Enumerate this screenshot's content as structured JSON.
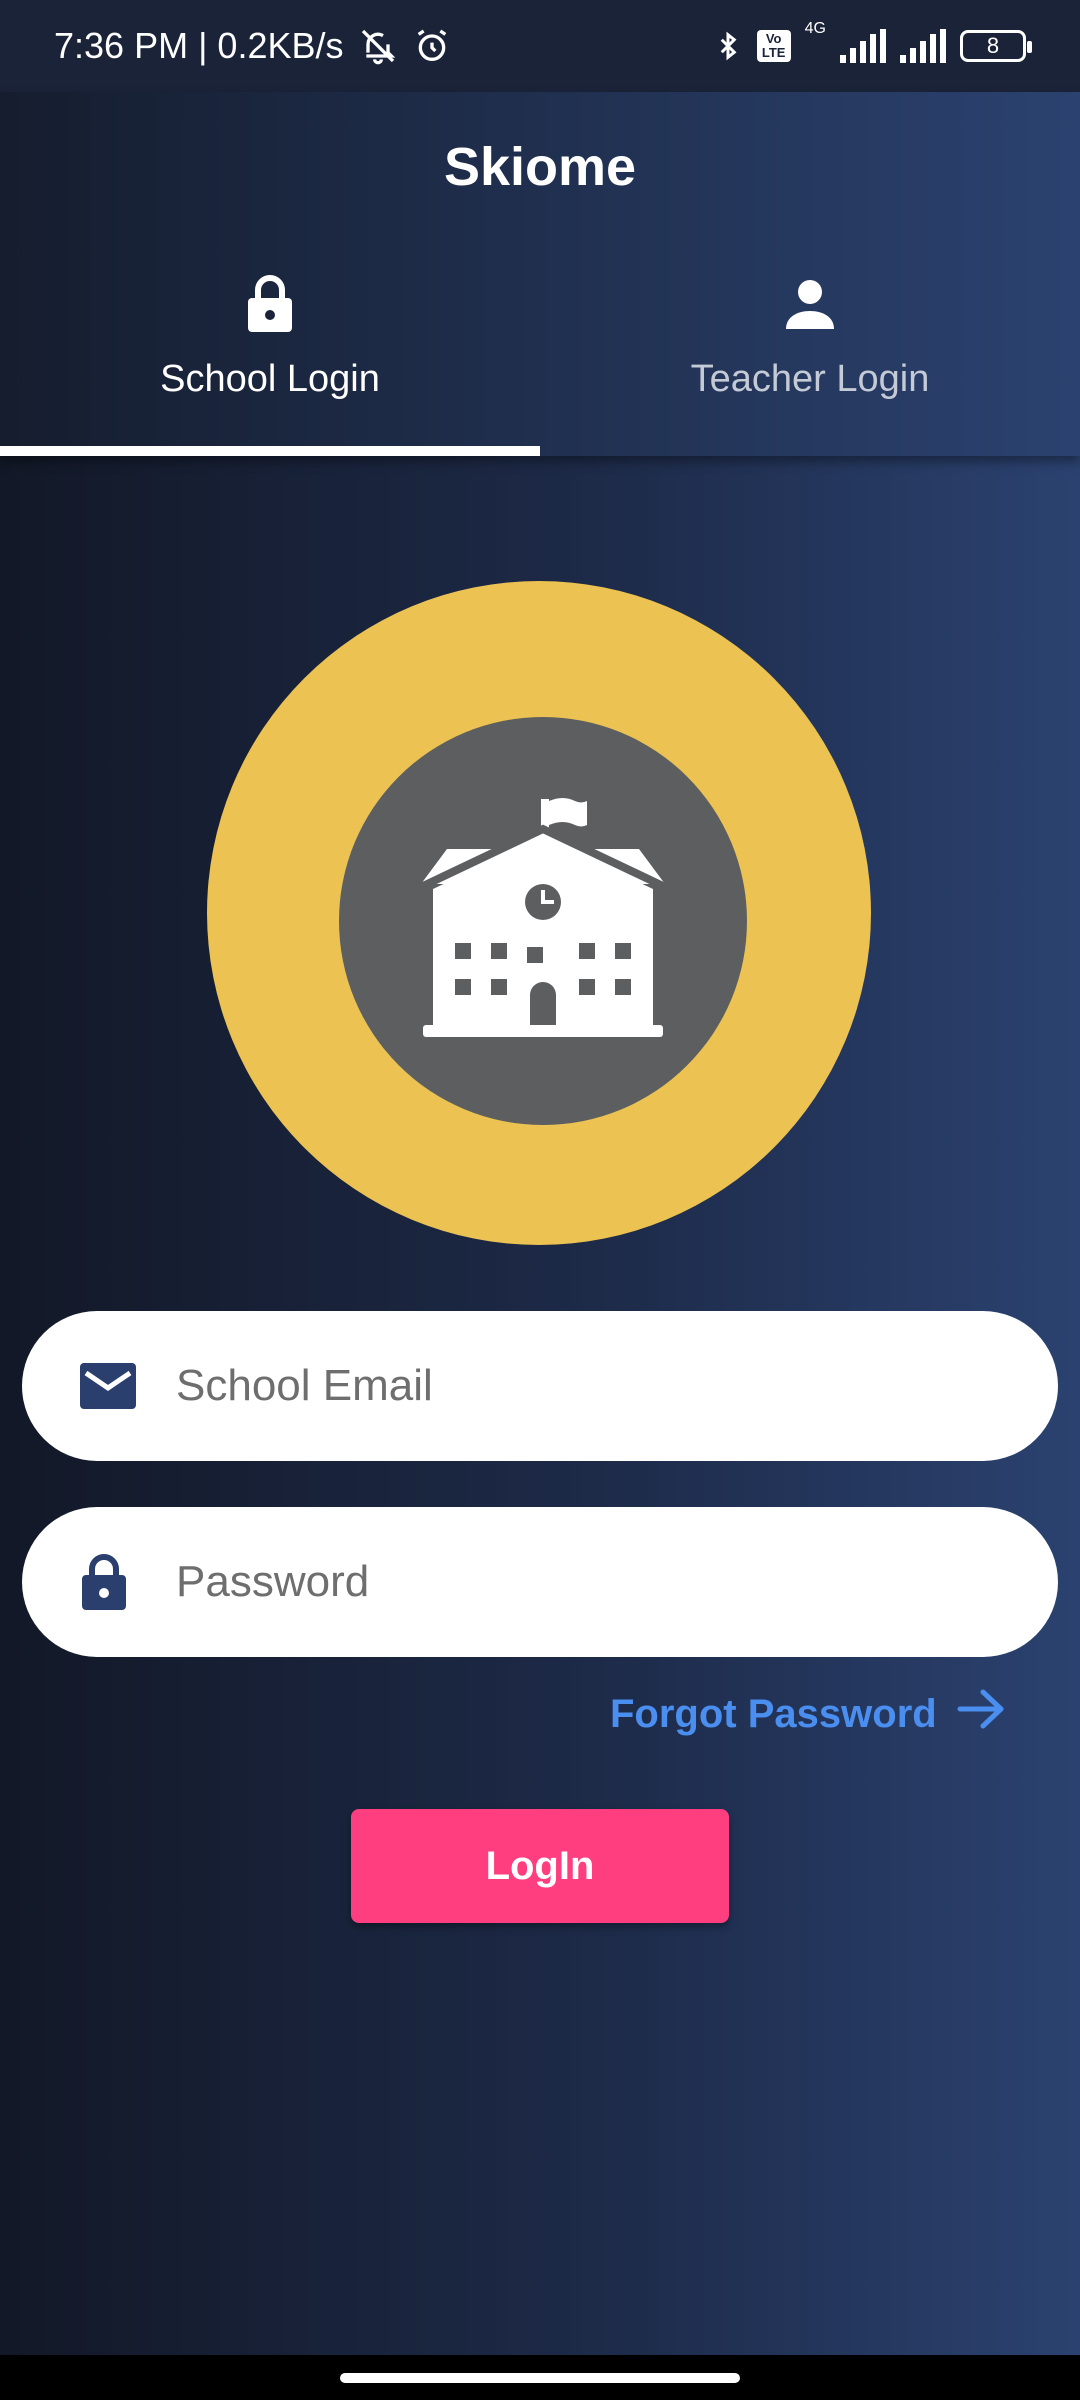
{
  "status_bar": {
    "time_speed": "7:36 PM | 0.2KB/s",
    "network_type": "4G",
    "volte": "Vo LTE",
    "battery": "8",
    "icons": [
      "bell-off-icon",
      "alarm-icon",
      "bluetooth-icon",
      "volte-icon",
      "signal-icon",
      "signal-icon",
      "battery-icon"
    ]
  },
  "header": {
    "title": "Skiome",
    "tabs": [
      {
        "label": "School Login",
        "icon": "lock-icon",
        "selected": true
      },
      {
        "label": "Teacher Login",
        "icon": "person-icon",
        "selected": false
      }
    ]
  },
  "logo": {
    "icon": "school-building-icon",
    "outer_color": "#ecc352",
    "inner_color": "#5d5e60"
  },
  "form": {
    "email_placeholder": "School Email",
    "email_value": "",
    "email_icon": "mail-icon",
    "password_placeholder": "Password",
    "password_value": "",
    "password_icon": "lock-icon",
    "forgot_label": "Forgot Password",
    "forgot_icon": "arrow-right-icon",
    "login_label": "LogIn"
  },
  "colors": {
    "accent_pink": "#fe3e7e",
    "link_blue": "#4a8ef0",
    "icon_navy": "#2a3f6e"
  }
}
